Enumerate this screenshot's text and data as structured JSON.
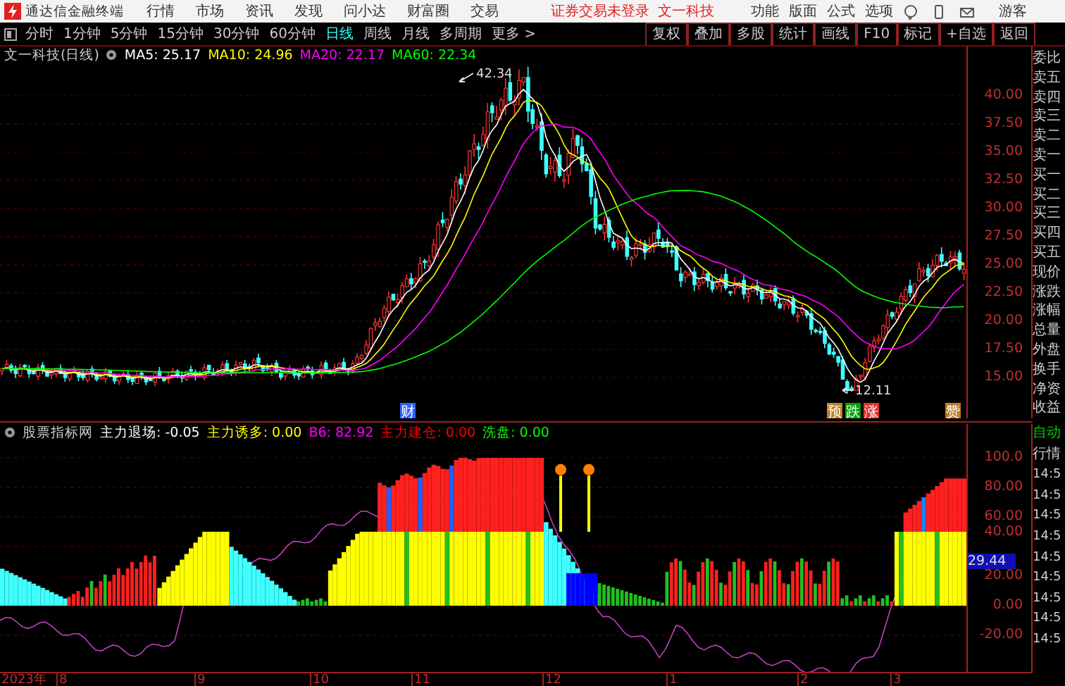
{
  "app": {
    "name": "通达信金融终端"
  },
  "menu": [
    "行情",
    "市场",
    "资讯",
    "发现",
    "问小达",
    "财富圈",
    "交易"
  ],
  "notice": {
    "login": "证券交易未登录",
    "stock": "文一科技"
  },
  "right_menu": [
    "功能",
    "版面",
    "公式",
    "选项"
  ],
  "user": "游客",
  "periods": [
    {
      "label": "分时",
      "selected": false
    },
    {
      "label": "1分钟",
      "selected": false
    },
    {
      "label": "5分钟",
      "selected": false
    },
    {
      "label": "15分钟",
      "selected": false
    },
    {
      "label": "30分钟",
      "selected": false
    },
    {
      "label": "60分钟",
      "selected": false
    },
    {
      "label": "日线",
      "selected": true
    },
    {
      "label": "周线",
      "selected": false
    },
    {
      "label": "月线",
      "selected": false
    },
    {
      "label": "多周期",
      "selected": false
    },
    {
      "label": "更多 >",
      "selected": false
    }
  ],
  "tools": [
    "复权",
    "叠加",
    "多股",
    "统计",
    "画线",
    "F10",
    "标记",
    "+自选",
    "返回"
  ],
  "price_panel": {
    "title": "文一科技(日线)",
    "ma": [
      {
        "label": "MA5: 25.17",
        "color": "#ffffff"
      },
      {
        "label": "MA10: 24.96",
        "color": "#ffff00"
      },
      {
        "label": "MA20: 22.17",
        "color": "#ff00ff"
      },
      {
        "label": "MA60: 22.34",
        "color": "#00ff00"
      }
    ],
    "yticks": [
      "40.00",
      "37.50",
      "35.00",
      "32.50",
      "30.00",
      "27.50",
      "25.00",
      "22.50",
      "20.00",
      "17.50",
      "15.00"
    ],
    "high_label": "42.34",
    "low_label": "12.11",
    "markers": [
      {
        "text": "财",
        "color": "#3060ff"
      },
      {
        "text": "预",
        "color": "#c08020"
      },
      {
        "text": "跌",
        "color": "#00a000"
      },
      {
        "text": "涨",
        "color": "#e03030"
      },
      {
        "text": "赞",
        "color": "#c08020"
      }
    ]
  },
  "indicator_panel": {
    "name": "股票指标网",
    "items": [
      {
        "label": "主力退场: -0.05",
        "color": "#ffffff"
      },
      {
        "label": "主力诱多: 0.00",
        "color": "#ffff00"
      },
      {
        "label": "B6: 82.92",
        "color": "#ff00ff"
      },
      {
        "label": "主力建仓: 0.00",
        "color": "#ff0000"
      },
      {
        "label": "洗盘: 0.00",
        "color": "#00ff00"
      }
    ],
    "yticks": [
      "100.0",
      "80.00",
      "60.00",
      "40.00",
      "20.00",
      "0.00",
      "-20.00"
    ],
    "current": "29.44"
  },
  "x_axis": [
    "2023年",
    "8",
    "9",
    "10",
    "11",
    "12",
    "1",
    "2",
    "3"
  ],
  "quote_panel": {
    "rows": [
      "委比",
      "卖五",
      "卖四",
      "卖三",
      "卖二",
      "卖一",
      "买一",
      "买二",
      "买三",
      "买四",
      "买五",
      "现价",
      "涨跌",
      "涨幅",
      "总量",
      "外盘",
      "换手",
      "净资",
      "收益"
    ],
    "lower": [
      "自动",
      "行情",
      "14:5",
      "14:5",
      "14:5",
      "14:5",
      "14:5",
      "14:5",
      "14:5",
      "14:5",
      "14:5"
    ]
  }
}
